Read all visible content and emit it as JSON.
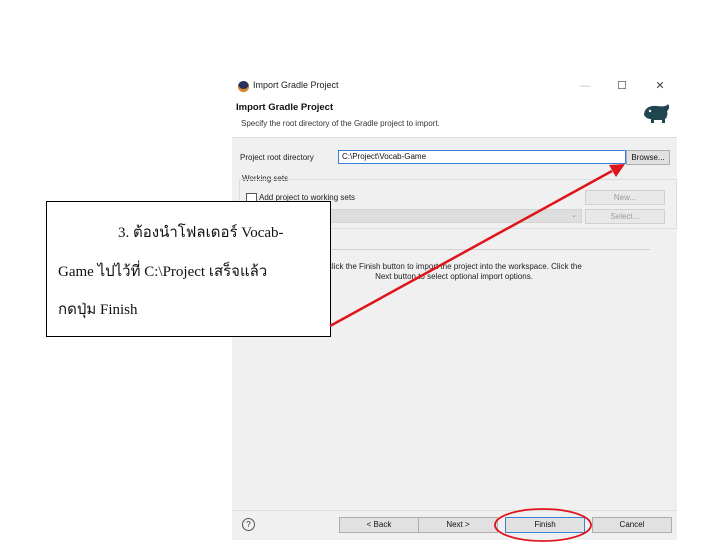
{
  "window": {
    "title": "Import Gradle Project",
    "minimize_glyph": "—",
    "maximize_glyph": "☐",
    "close_glyph": "✕"
  },
  "header": {
    "title": "Import Gradle Project",
    "subtitle": "Specify the root directory of the Gradle project to import.",
    "logo_icon": "gradle-elephant-icon"
  },
  "form": {
    "root_label": "Project root directory",
    "root_value": "C:\\Project\\Vocab-Game",
    "browse_label": "Browse...",
    "working_sets_label": "Working sets",
    "add_to_working_sets_label": "Add project to working sets",
    "add_to_working_sets_checked": false,
    "new_label": "New...",
    "select_label": "Select..."
  },
  "info_text": "Click the Finish button to import the project into the workspace. Click the Next button to select optional import options.",
  "footer": {
    "help_glyph": "?",
    "back_label": "< Back",
    "next_label": "Next >",
    "finish_label": "Finish",
    "cancel_label": "Cancel"
  },
  "annotation": {
    "line1": "3. ต้องนำโฟลเดอร์ Vocab-",
    "line2": "Game ไปไว้ที่ C:\\Project เสร็จแล้ว",
    "line3": "กดปุ่ม Finish",
    "arrow_color": "#e0141b",
    "highlight_color": "#e0141b"
  }
}
